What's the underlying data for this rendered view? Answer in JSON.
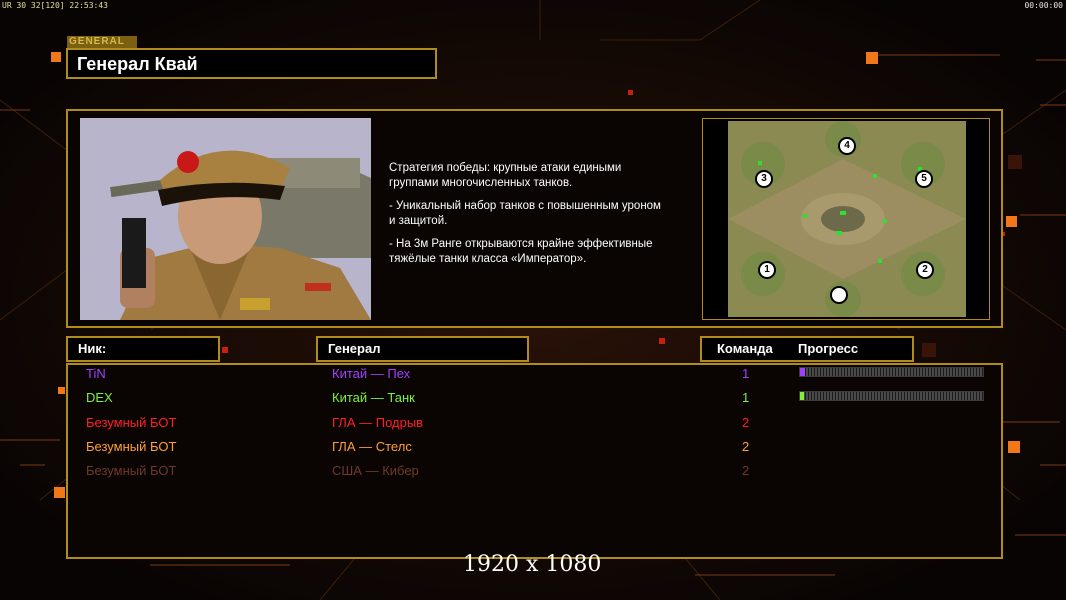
{
  "hud": {
    "left": "UR 30 32[120] 22:53:43",
    "right": "00:00:00"
  },
  "general_tag": "GENERAL",
  "title": "Генерал Квай",
  "description": [
    "Стратегия победы: крупные атаки едиными\n группами многочисленных танков.",
    "- Уникальный набор танков с повышенным уроном\n и защитой.",
    "- На 3м Ранге открываются крайне эффективные\n тяжёлые танки класса «Император»."
  ],
  "map_spawns": [
    "1",
    "2",
    "3",
    "4",
    "5"
  ],
  "table_headers": {
    "nick": "Ник:",
    "general": "Генерал",
    "team": "Команда",
    "progress": "Прогресс"
  },
  "players": [
    {
      "nick": "TiN",
      "general": "Китай — Пех",
      "team": "1",
      "color": "#a040ff",
      "progress": 0.025
    },
    {
      "nick": "DEX",
      "general": "Китай — Танк",
      "team": "1",
      "color": "#7ef23a",
      "progress": 0.015
    },
    {
      "nick": "Безумный БОТ",
      "general": "ГЛА — Подрыв",
      "team": "2",
      "color": "#ff2020",
      "progress": null
    },
    {
      "nick": "Безумный БОТ",
      "general": "ГЛА — Стелс",
      "team": "2",
      "color": "#ffa030",
      "progress": null
    },
    {
      "nick": "Безумный БОТ",
      "general": "США — Кибер",
      "team": "2",
      "color": "#6e3a28",
      "progress": null
    }
  ],
  "resolution": "1920 x 1080"
}
